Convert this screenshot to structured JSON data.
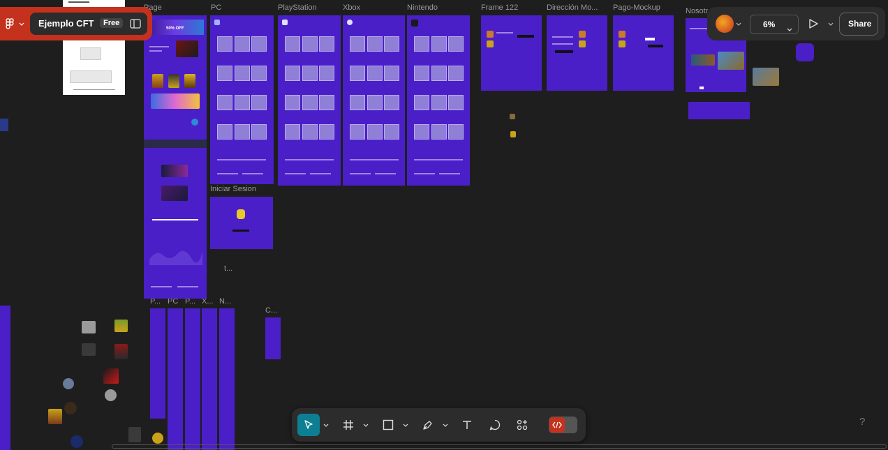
{
  "file": {
    "name": "Ejemplo CFT",
    "plan_badge": "Free"
  },
  "zoom": "6%",
  "share_label": "Share",
  "help_label": "?",
  "frame_labels": {
    "page": "Page",
    "pc": "PC",
    "playstation": "PlayStation",
    "xbox": "Xbox",
    "nintendo": "Nintendo",
    "frame122": "Frame 122",
    "direccion": "Dirección Mo...",
    "pago": "Pago-Mockup",
    "nosotros": "Nosotr",
    "iniciar_sesion": "Iniciar Sesion",
    "t_small": "t...",
    "m_p1": "P...",
    "m_pc": "PC",
    "m_p2": "P...",
    "m_x": "X...",
    "m_n": "N...",
    "m_c": "C..."
  },
  "banner_text": "50% OFF",
  "toolbar": {
    "move": "move-tool",
    "frame": "frame-tool",
    "shape": "rectangle-tool",
    "pen": "pen-tool",
    "text": "text-tool",
    "comment": "comment-tool",
    "actions": "actions-tool",
    "dev": "dev-mode-toggle"
  },
  "colors": {
    "accent": "#0c8ce9",
    "brand_red": "#c4311d",
    "canvas": "#1e1e1e",
    "frame_purple": "#4b1fc7"
  }
}
